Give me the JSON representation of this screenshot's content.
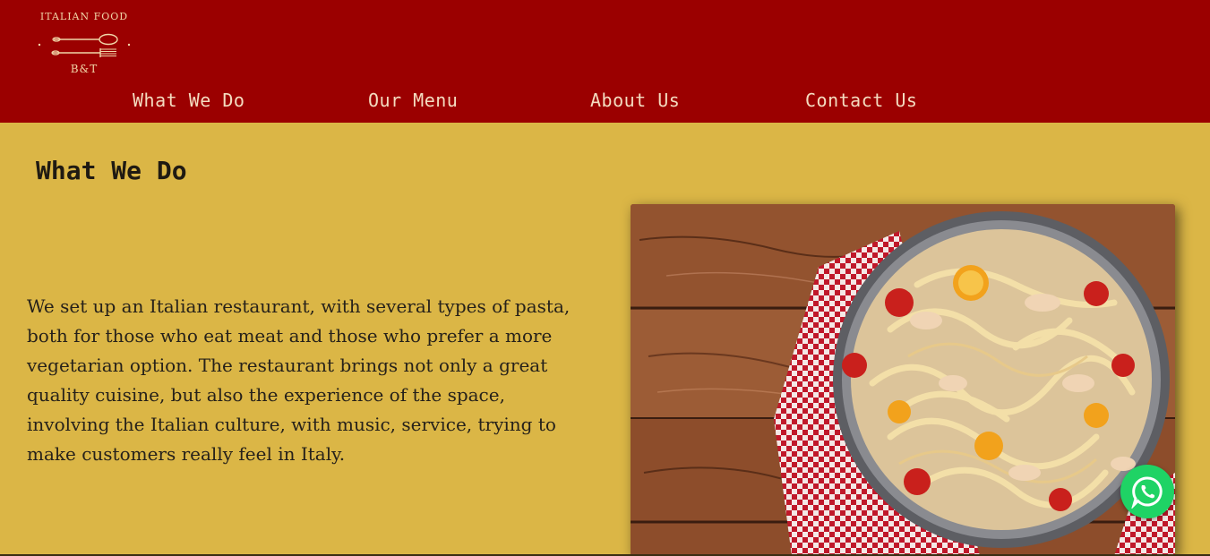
{
  "logo": {
    "top_text": "ITALIAN FOOD",
    "bottom_text": "B&T",
    "icon": "fork-and-spoon-icon"
  },
  "nav": {
    "items": [
      {
        "label": "What We Do"
      },
      {
        "label": "Our Menu"
      },
      {
        "label": "About Us"
      },
      {
        "label": "Contact Us"
      }
    ]
  },
  "main": {
    "title": "What We Do",
    "paragraph": "We set up an Italian restaurant, with several types of pasta, both for those who eat meat and those who prefer a more vegetarian option. The restaurant brings not only a great quality cuisine, but also the experience of the space, involving the Italian culture, with music, service, trying to make customers really feel in Italy.",
    "image": "pasta-dish-photo"
  },
  "whatsapp": {
    "icon": "whatsapp-icon"
  },
  "colors": {
    "header_bg": "#9b0000",
    "page_bg": "#dbb646",
    "nav_text": "#f4dcc0",
    "whatsapp_green": "#1fd365"
  }
}
